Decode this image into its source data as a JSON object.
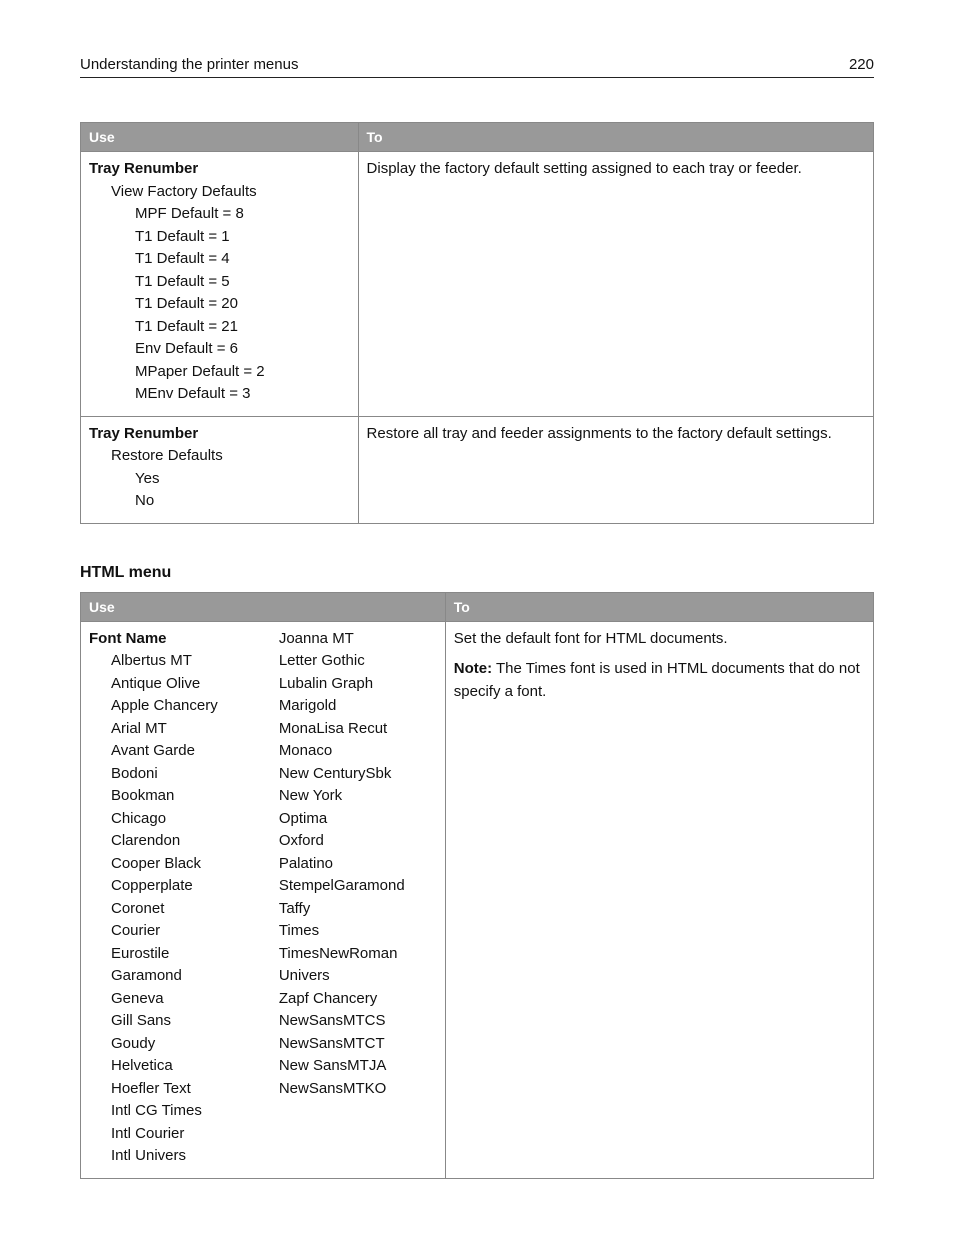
{
  "header": {
    "title": "Understanding the printer menus",
    "page_number": "220"
  },
  "table1": {
    "headers": {
      "use": "Use",
      "to": "To"
    },
    "rows": [
      {
        "title": "Tray Renumber",
        "subtitle": "View Factory Defaults",
        "items": [
          "MPF Default = 8",
          "T1 Default = 1",
          "T1 Default = 4",
          "T1 Default = 5",
          "T1 Default = 20",
          "T1 Default = 21",
          "Env Default = 6",
          "MPaper Default = 2",
          "MEnv Default = 3"
        ],
        "to": "Display the factory default setting assigned to each tray or feeder."
      },
      {
        "title": "Tray Renumber",
        "subtitle": "Restore Defaults",
        "items": [
          "Yes",
          "No"
        ],
        "to": "Restore all tray and feeder assignments to the factory default settings."
      }
    ]
  },
  "section2_heading": "HTML menu",
  "table2": {
    "headers": {
      "use": "Use",
      "to": "To"
    },
    "row": {
      "title": "Font Name",
      "col1": [
        "Albertus MT",
        "Antique Olive",
        "Apple Chancery",
        "Arial MT",
        "Avant Garde",
        "Bodoni",
        "Bookman",
        "Chicago",
        "Clarendon",
        "Cooper Black",
        "Copperplate",
        "Coronet",
        "Courier",
        "Eurostile",
        "Garamond",
        "Geneva",
        "Gill Sans",
        "Goudy",
        "Helvetica",
        "Hoefler Text",
        "Intl CG Times",
        "Intl Courier",
        "Intl Univers"
      ],
      "col2": [
        "Joanna MT",
        "Letter Gothic",
        "Lubalin Graph",
        "Marigold",
        "MonaLisa Recut",
        "Monaco",
        "New CenturySbk",
        "New York",
        "Optima",
        "Oxford",
        "Palatino",
        "StempelGaramond",
        "Taffy",
        "Times",
        "TimesNewRoman",
        "Univers",
        "Zapf Chancery",
        "NewSansMTCS",
        "NewSansMTCT",
        "New SansMTJA",
        "NewSansMTKO"
      ],
      "to_line1": "Set the default font for HTML documents.",
      "note_label": "Note:",
      "note_text": " The Times font is used in HTML documents that do not specify a font."
    }
  }
}
